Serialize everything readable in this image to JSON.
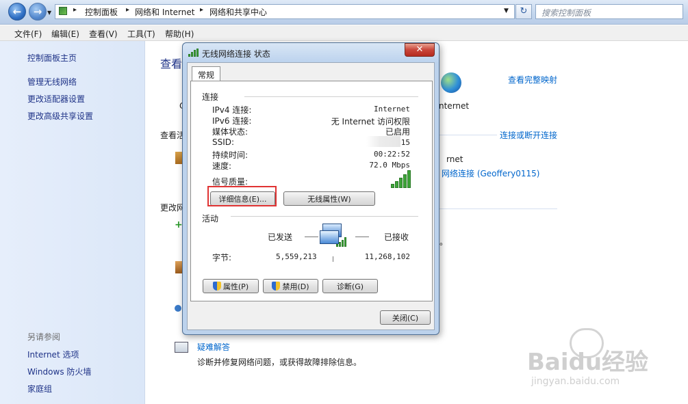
{
  "address_bar": {
    "breadcrumb": [
      "控制面板",
      "网络和 Internet",
      "网络和共享中心"
    ],
    "search_placeholder": "搜索控制面板"
  },
  "menu": [
    "文件(F)",
    "编辑(E)",
    "查看(V)",
    "工具(T)",
    "帮助(H)"
  ],
  "sidebar": {
    "home": "控制面板主页",
    "links": [
      "管理无线网络",
      "更改适配器设置",
      "更改高级共享设置"
    ],
    "see_also_heading": "另请参阅",
    "see_also": [
      "Internet 选项",
      "Windows 防火墙",
      "家庭组"
    ]
  },
  "main": {
    "heading_partial": "查看",
    "view_full_map": "查看完整映射",
    "active_partial": "查看活",
    "connect_disconnect": "连接或断开连接",
    "change_partial": "更改网",
    "internet_label_1": "nternet",
    "internet_label_2": "rnet",
    "wireless_link": "网络连接 (Geoffery0115)",
    "c_letter": "C",
    "period": "。",
    "troubleshoot_title": "疑难解答",
    "troubleshoot_desc": "诊断并修复网络问题，或获得故障排除信息。"
  },
  "dialog": {
    "title": "无线网络连接 状态",
    "tab": "常规",
    "connection_group": "连接",
    "rows": [
      {
        "label": "IPv4 连接:",
        "value": "Internet"
      },
      {
        "label": "IPv6 连接:",
        "value": "无 Internet 访问权限"
      },
      {
        "label": "媒体状态:",
        "value": "已启用"
      },
      {
        "label": "SSID:",
        "value": "15"
      },
      {
        "label": "持续时间:",
        "value": "00:22:52"
      },
      {
        "label": "速度:",
        "value": "72.0 Mbps"
      }
    ],
    "signal_label": "信号质量:",
    "signal_bars": 5,
    "details_button": "详细信息(E)...",
    "wireless_props_button": "无线属性(W)",
    "activity_group": "活动",
    "sent_label": "已发送",
    "received_label": "已接收",
    "bytes_label": "字节:",
    "bytes_sent": "5,559,213",
    "bytes_received": "11,268,102",
    "properties_button": "属性(P)",
    "disable_button": "禁用(D)",
    "diagnose_button": "诊断(G)",
    "close_button": "关闭(C)"
  },
  "watermark": {
    "brand": "Baidu经验",
    "url": "jingyan.baidu.com"
  }
}
